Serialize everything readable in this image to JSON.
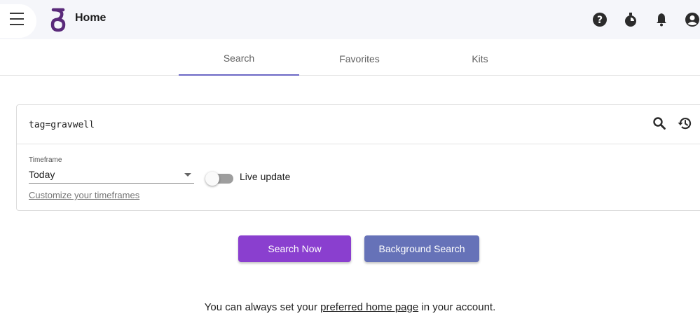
{
  "header": {
    "title": "Home",
    "logo_letter": "g",
    "icons": [
      "help-icon",
      "timer-icon",
      "notifications-icon",
      "account-icon"
    ]
  },
  "tabs": [
    {
      "label": "Search",
      "active": true
    },
    {
      "label": "Favorites",
      "active": false
    },
    {
      "label": "Kits",
      "active": false
    }
  ],
  "search": {
    "query": "tag=gravwell",
    "timeframe_label": "Timeframe",
    "timeframe_value": "Today",
    "customize_link": "Customize your timeframes",
    "live_update_label": "Live update",
    "live_update_on": false
  },
  "buttons": {
    "search_now": "Search Now",
    "background_search": "Background Search"
  },
  "footer": {
    "prefix": "You can always set your ",
    "link": "preferred home page",
    "suffix": " in your account."
  },
  "colors": {
    "accent_purple": "#8a3fcf",
    "accent_indigo": "#6672b8",
    "tab_indicator": "#6c68c5",
    "logo": "#5a2a7a"
  }
}
